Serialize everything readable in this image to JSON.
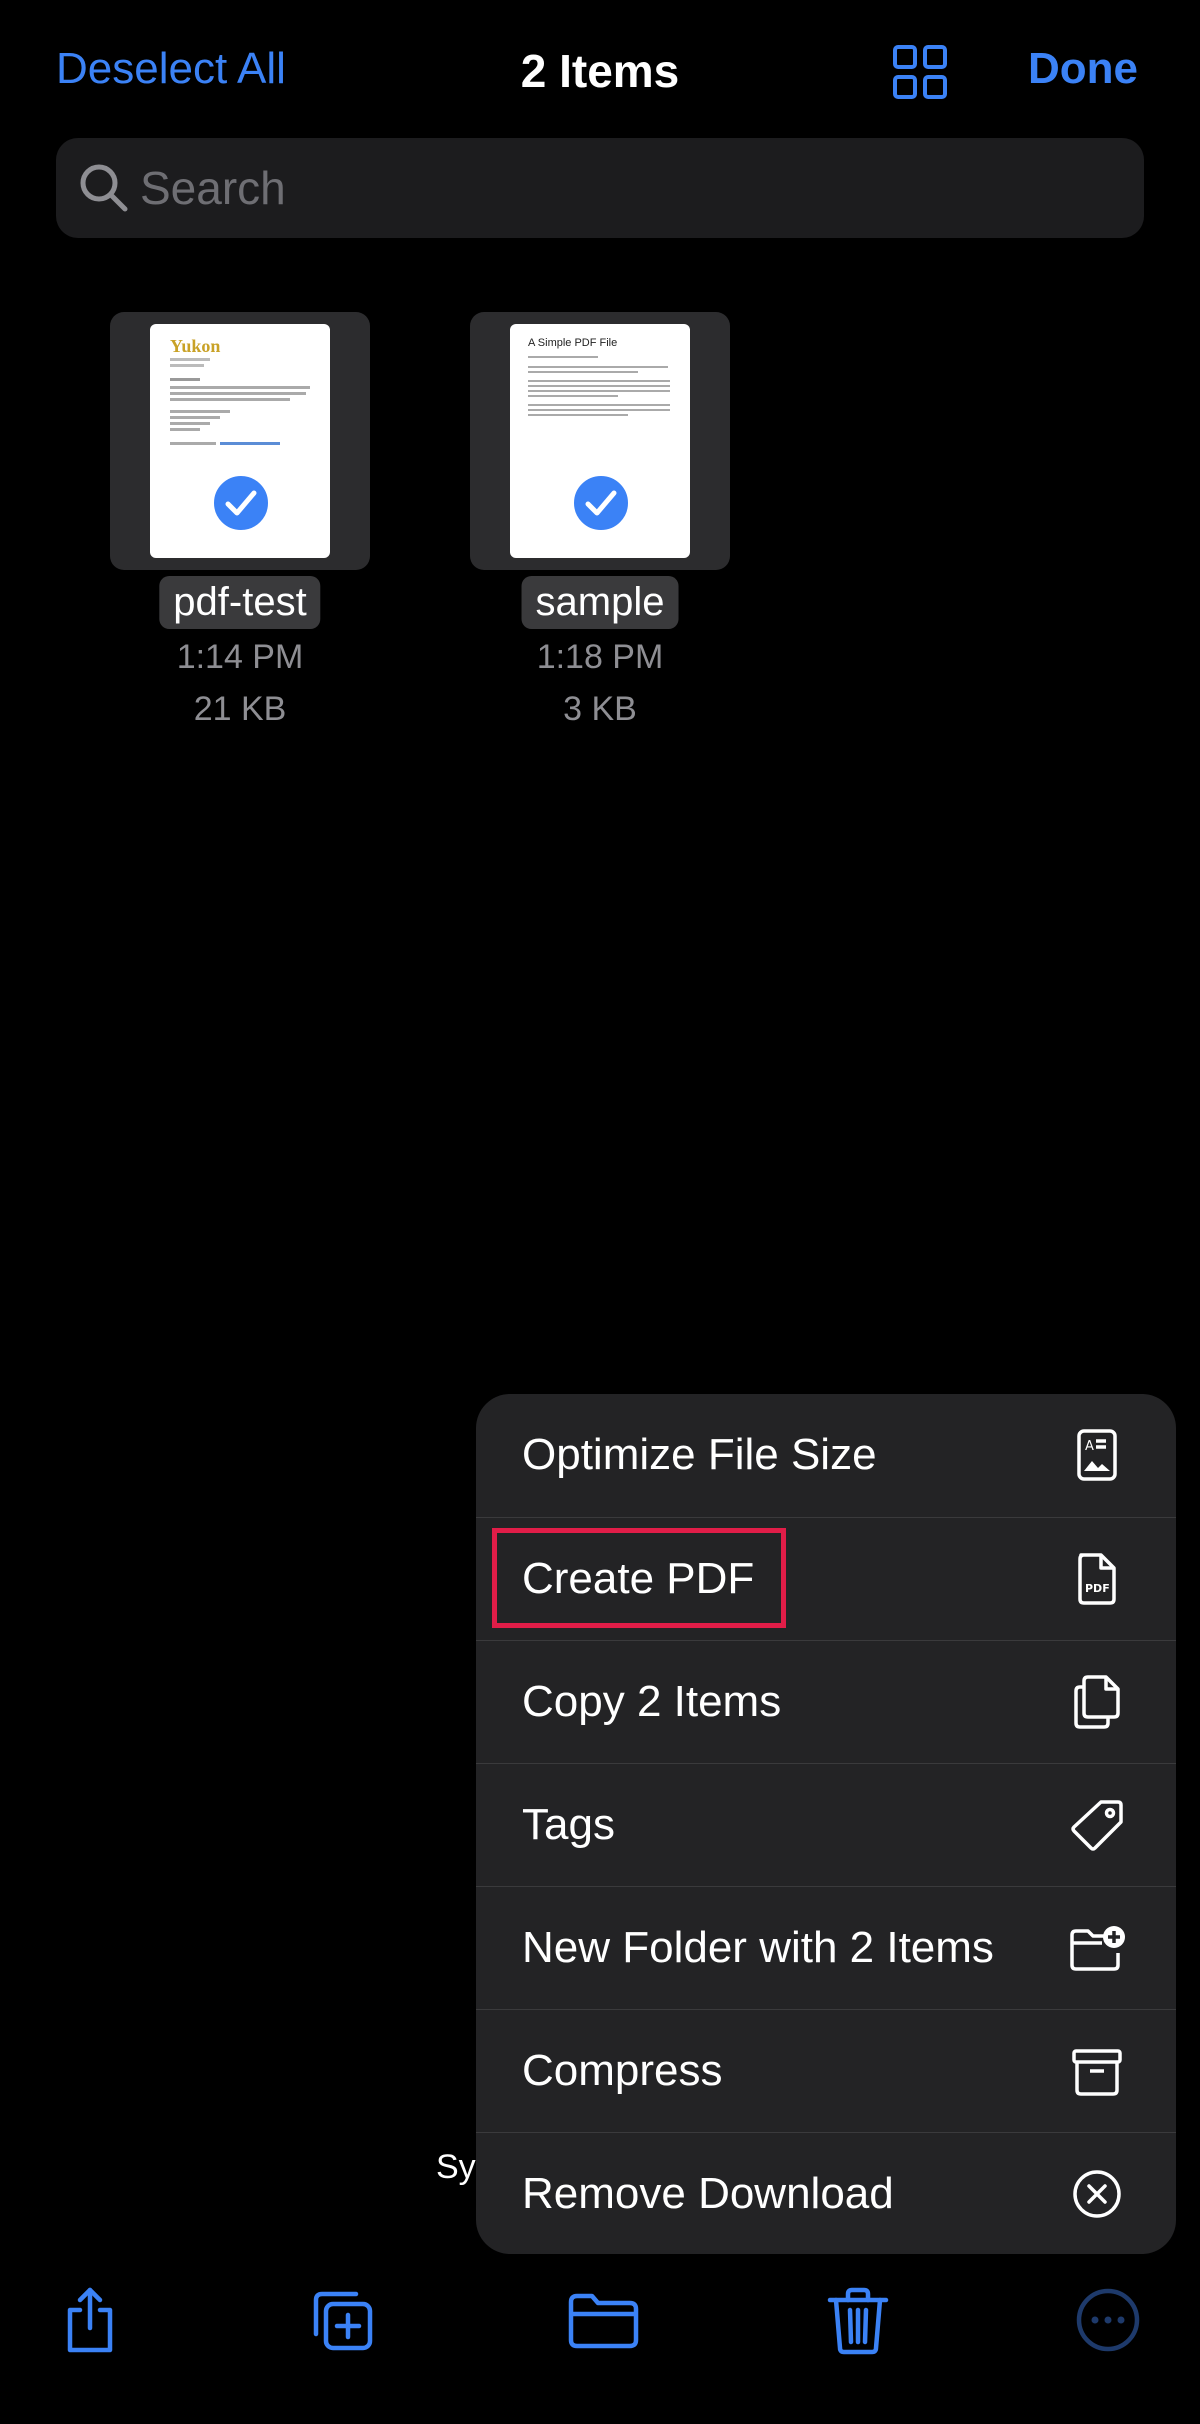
{
  "nav": {
    "deselect_label": "Deselect All",
    "title": "2 Items",
    "done_label": "Done"
  },
  "search": {
    "placeholder": "Search"
  },
  "files": [
    {
      "name": "pdf-test",
      "time": "1:14 PM",
      "size": "21 KB",
      "selected": true
    },
    {
      "name": "sample",
      "time": "1:18 PM",
      "size": "3 KB",
      "selected": true
    }
  ],
  "thumbnails": {
    "file_1_logo": "Yukon",
    "file_2_heading": "A Simple PDF File"
  },
  "background_text": "Sy",
  "menu": {
    "items": [
      {
        "label": "Optimize File Size",
        "icon": "optimize-doc-icon"
      },
      {
        "label": "Create PDF",
        "icon": "pdf-doc-icon",
        "highlighted": true
      },
      {
        "label": "Copy 2 Items",
        "icon": "copy-docs-icon"
      },
      {
        "label": "Tags",
        "icon": "tag-icon"
      },
      {
        "label": "New Folder with 2 Items",
        "icon": "folder-plus-icon"
      },
      {
        "label": "Compress",
        "icon": "archive-box-icon"
      },
      {
        "label": "Remove Download",
        "icon": "x-circle-icon"
      }
    ]
  },
  "toolbar": {
    "items": [
      "share-icon",
      "duplicate-icon",
      "move-folder-icon",
      "trash-icon",
      "more-icon"
    ]
  },
  "colors": {
    "accent": "#3b82f6",
    "highlight_box": "#e11d48",
    "menu_bg": "#232325",
    "search_bg": "#1c1c1e"
  }
}
